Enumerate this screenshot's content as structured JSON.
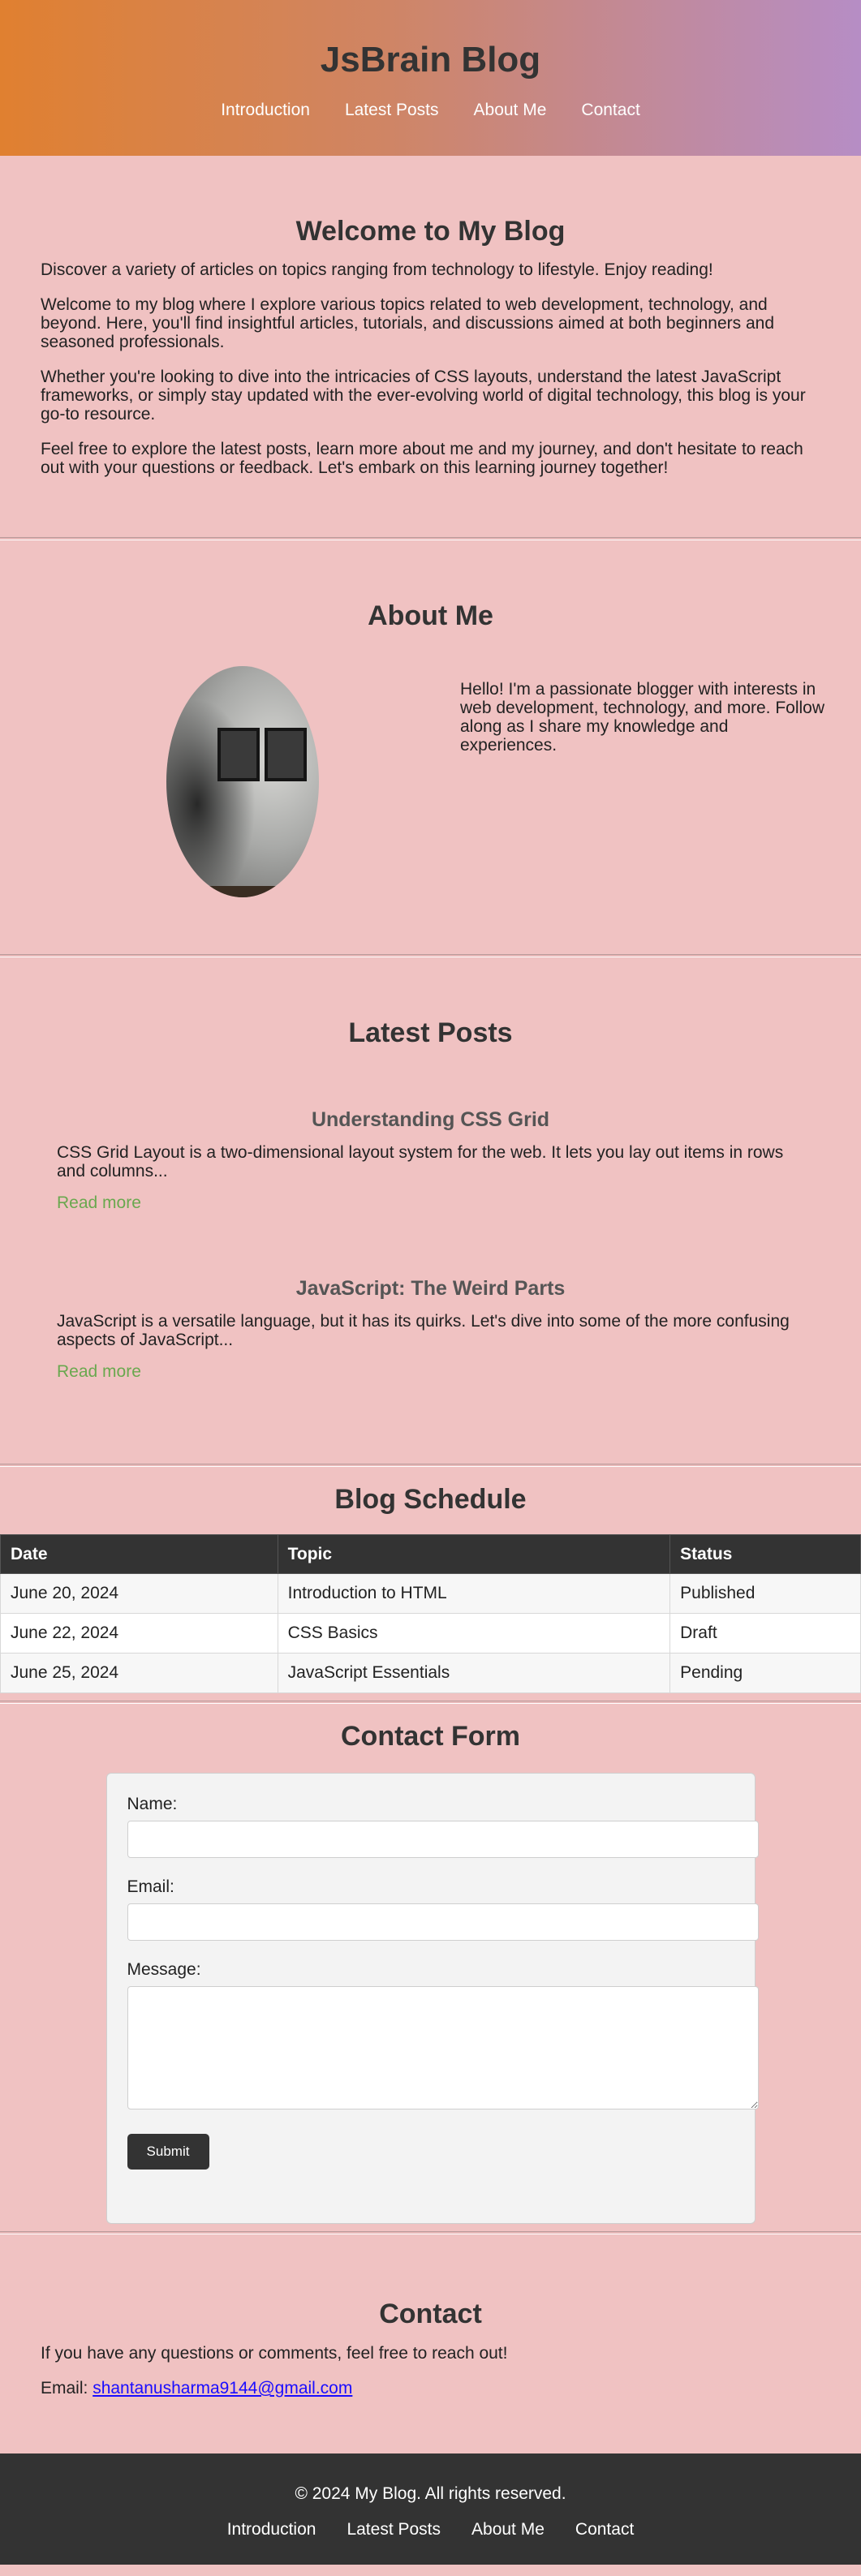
{
  "header": {
    "title": "JsBrain Blog",
    "nav": [
      "Introduction",
      "Latest Posts",
      "About Me",
      "Contact"
    ]
  },
  "welcome": {
    "title": "Welcome to My Blog",
    "paragraphs": [
      "Discover a variety of articles on topics ranging from technology to lifestyle. Enjoy reading!",
      "Welcome to my blog where I explore various topics related to web development, technology, and beyond. Here, you'll find insightful articles, tutorials, and discussions aimed at both beginners and seasoned professionals.",
      "Whether you're looking to dive into the intricacies of CSS layouts, understand the latest JavaScript frameworks, or simply stay updated with the ever-evolving world of digital technology, this blog is your go-to resource.",
      "Feel free to explore the latest posts, learn more about me and my journey, and don't hesitate to reach out with your questions or feedback. Let's embark on this learning journey together!"
    ]
  },
  "about": {
    "title": "About Me",
    "text": "Hello! I'm a passionate blogger with interests in web development, technology, and more. Follow along as I share my knowledge and experiences."
  },
  "posts": {
    "title": "Latest Posts",
    "items": [
      {
        "title": "Understanding CSS Grid",
        "excerpt": "CSS Grid Layout is a two-dimensional layout system for the web. It lets you lay out items in rows and columns...",
        "link": "Read more"
      },
      {
        "title": "JavaScript: The Weird Parts",
        "excerpt": "JavaScript is a versatile language, but it has its quirks. Let's dive into some of the more confusing aspects of JavaScript...",
        "link": "Read more"
      }
    ]
  },
  "schedule": {
    "title": "Blog Schedule",
    "headers": [
      "Date",
      "Topic",
      "Status"
    ],
    "rows": [
      [
        "June 20, 2024",
        "Introduction to HTML",
        "Published"
      ],
      [
        "June 22, 2024",
        "CSS Basics",
        "Draft"
      ],
      [
        "June 25, 2024",
        "JavaScript Essentials",
        "Pending"
      ]
    ]
  },
  "contact_form": {
    "title": "Contact Form",
    "name_label": "Name:",
    "email_label": "Email:",
    "message_label": "Message:",
    "name_value": "",
    "email_value": "",
    "message_value": "",
    "submit_label": "Submit"
  },
  "contact": {
    "title": "Contact",
    "text": "If you have any questions or comments, feel free to reach out!",
    "email_prefix": "Email: ",
    "email": "shantanusharma9144@gmail.com"
  },
  "footer": {
    "copyright": "© 2024 My Blog. All rights reserved.",
    "nav": [
      "Introduction",
      "Latest Posts",
      "About Me",
      "Contact"
    ]
  },
  "colors": {
    "page_background": "#f0c2c2",
    "header_gradient_start": "#e08030",
    "header_gradient_end": "#b68dc5",
    "dark": "#333333",
    "read_more": "#6aa84f",
    "link": "#1a0dff"
  }
}
